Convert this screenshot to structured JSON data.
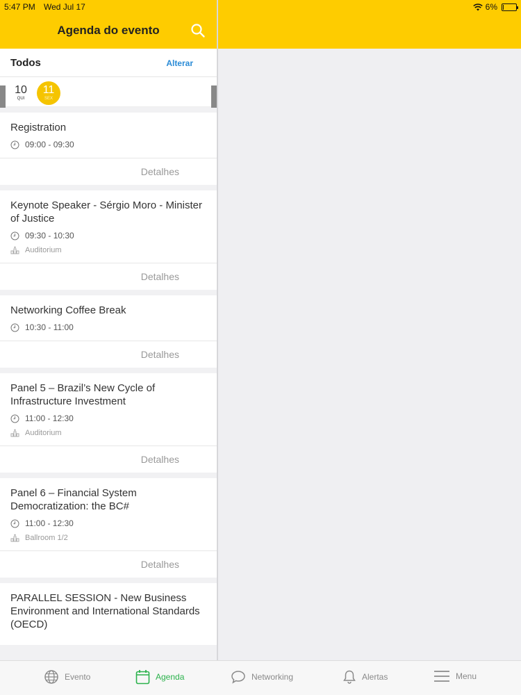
{
  "status": {
    "time": "5:47 PM",
    "date": "Wed Jul 17",
    "battery": "6%",
    "battery_level": 0.06
  },
  "header": {
    "title": "Agenda do evento"
  },
  "filter": {
    "label": "Todos",
    "change": "Alterar"
  },
  "days": [
    {
      "num": "10",
      "dow": "QUI"
    },
    {
      "num": "11",
      "dow": "SEX"
    }
  ],
  "sessions": [
    {
      "title": "Registration",
      "time": "09:00 - 09:30",
      "location": "",
      "details": "Detalhes"
    },
    {
      "title": "Keynote Speaker - Sérgio Moro - Minister of Justice",
      "time": "09:30 - 10:30",
      "location": "Auditorium",
      "details": "Detalhes"
    },
    {
      "title": "Networking Coffee Break",
      "time": "10:30 - 11:00",
      "location": "",
      "details": "Detalhes"
    },
    {
      "title": "Panel 5 – Brazil’s New Cycle of Infrastructure Investment",
      "time": "11:00 - 12:30",
      "location": "Auditorium",
      "details": "Detalhes"
    },
    {
      "title": "Panel 6 – Financial System Democratization: the BC#",
      "time": "11:00 - 12:30",
      "location": "Ballroom 1/2",
      "details": "Detalhes"
    },
    {
      "title": "PARALLEL SESSION - New Business Environment and International Standards (OECD)",
      "time": "",
      "location": "",
      "details": ""
    }
  ],
  "tabs": [
    {
      "label": "Evento",
      "icon": "globe-icon"
    },
    {
      "label": "Agenda",
      "icon": "calendar-icon"
    },
    {
      "label": "Networking",
      "icon": "chat-bubble-icon"
    },
    {
      "label": "Alertas",
      "icon": "bell-icon"
    },
    {
      "label": "Menu",
      "icon": "hamburger-icon"
    }
  ],
  "colors": {
    "brand": "#fecc00",
    "active_tab": "#2bb24c",
    "link": "#2a8bd6"
  }
}
